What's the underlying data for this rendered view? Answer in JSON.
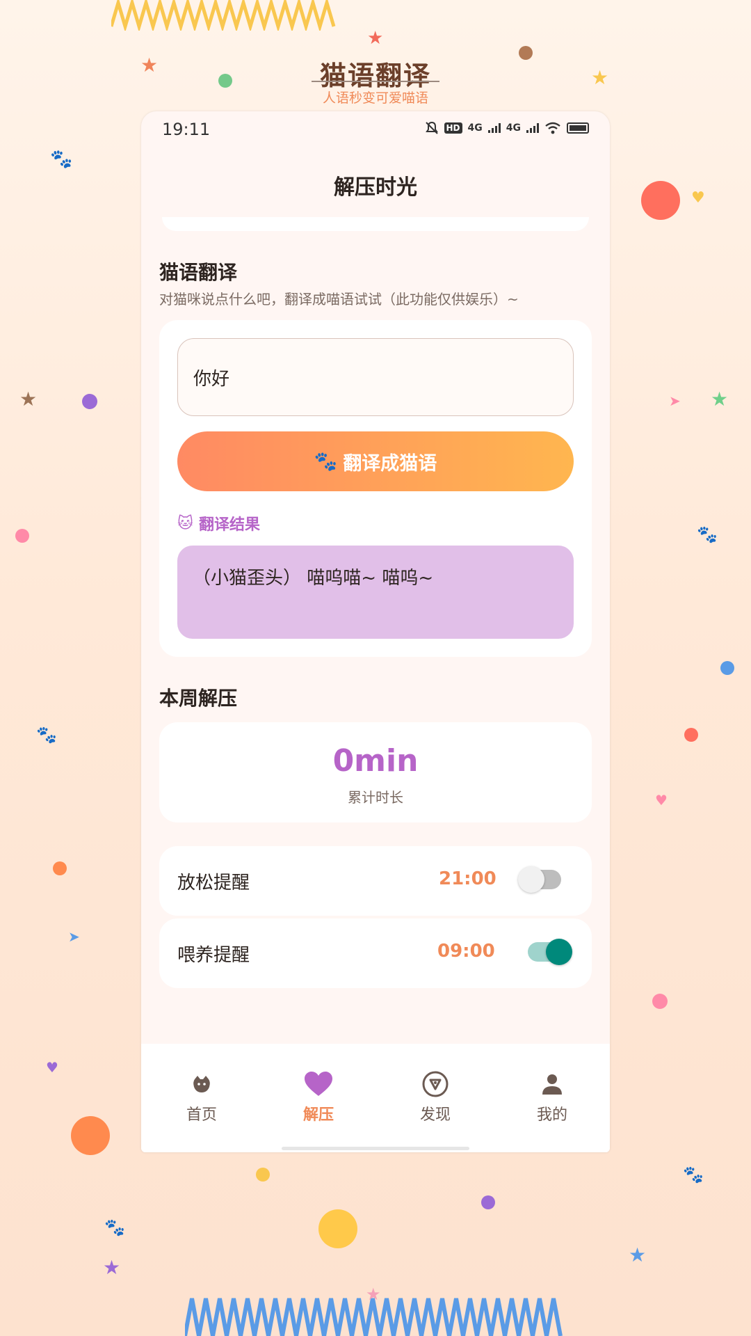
{
  "banner": {
    "title": "猫语翻译",
    "subtitle": "人语秒变可爱喵语"
  },
  "status_bar": {
    "time": "19:11",
    "icons": [
      "bell-off-icon",
      "hd-icon",
      "signal-4g-icon",
      "signal-4g-icon",
      "wifi-icon",
      "battery-icon"
    ],
    "hd_text": "HD",
    "net_1": "4G",
    "net_2": "4G"
  },
  "page": {
    "title": "解压时光"
  },
  "translator": {
    "heading": "猫语翻译",
    "description": "对猫咪说点什么吧，翻译成喵语试试（此功能仅供娱乐）~",
    "input_value": "你好",
    "button_icon": "🐾",
    "button_label": "翻译成猫语",
    "result_icon": "🐱",
    "result_label": "翻译结果",
    "result_text": "（小猫歪头） 喵呜喵~ 喵呜~"
  },
  "weekly": {
    "heading": "本周解压",
    "value": "0min",
    "label": "累计时长"
  },
  "reminders": [
    {
      "name": "放松提醒",
      "time": "21:00",
      "enabled": false
    },
    {
      "name": "喂养提醒",
      "time": "09:00",
      "enabled": true
    }
  ],
  "tabs": [
    {
      "label": "首页",
      "icon": "cat-face-icon",
      "active": false
    },
    {
      "label": "解压",
      "icon": "heart-icon",
      "active": true
    },
    {
      "label": "发现",
      "icon": "compass-icon",
      "active": false
    },
    {
      "label": "我的",
      "icon": "person-icon",
      "active": false
    }
  ],
  "colors": {
    "accent_orange": "#f08a58",
    "accent_purple": "#b664c8",
    "toggle_on": "#00897b",
    "result_bg": "#e1bfe8"
  }
}
